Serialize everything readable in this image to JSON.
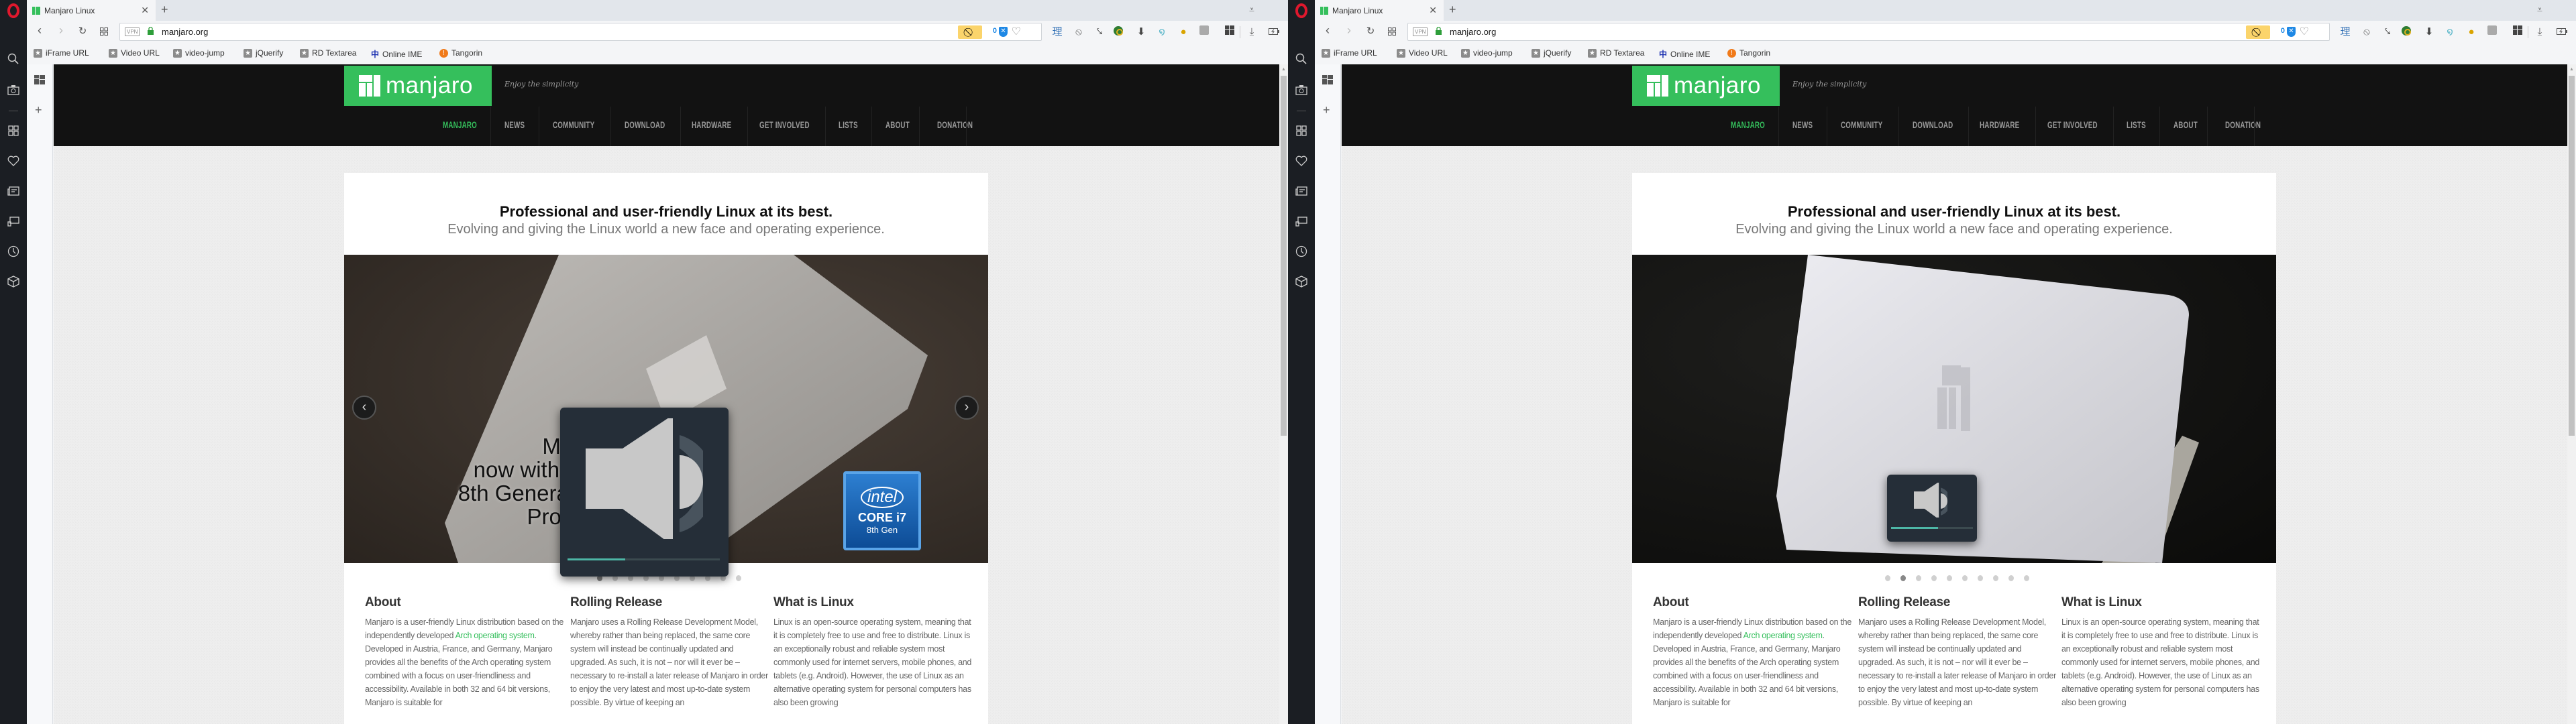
{
  "browser": {
    "tab_title": "Manjaro Linux",
    "tab_close": "✕",
    "new_tab": "+",
    "url": "manjaro.org",
    "vpn_label": "VPN",
    "blocked_count": "0",
    "bookmarks": [
      {
        "label": "iFrame URL",
        "icon": "star-icon"
      },
      {
        "label": "Video URL",
        "icon": "star-icon"
      },
      {
        "label": "video-jump",
        "icon": "star-icon"
      },
      {
        "label": "jQuerify",
        "icon": "star-icon"
      },
      {
        "label": "RD Textarea",
        "icon": "star-icon"
      },
      {
        "label": "Online IME",
        "icon": "ime-icon"
      },
      {
        "label": "Tangorin",
        "icon": "tangorin-icon"
      }
    ],
    "extension_glyph_1": "理",
    "accent": "#35bf5c"
  },
  "page": {
    "logo_text": "manjaro",
    "tagline": "Enjoy the simplicity",
    "nav": [
      "MANJARO",
      "NEWS",
      "COMMUNITY",
      "DOWNLOAD",
      "HARDWARE",
      "GET INVOLVED",
      "LISTS",
      "ABOUT",
      "DONATION"
    ],
    "active_nav": "MANJARO",
    "headline": "Professional and user-friendly Linux at its best.",
    "subheadline": "Evolving and giving the Linux world a new face and operating experience.",
    "prev_label": "‹",
    "next_label": "›",
    "slide_caption": [
      "Manjaro",
      "now with Intel Refresh",
      "8th Generation Intel Core",
      "Processors"
    ],
    "intel_badge": {
      "brand": "intel",
      "line1": "CORE i7",
      "line2": "8th Gen"
    },
    "columns": [
      {
        "title": "About",
        "text_before": "Manjaro is a user-friendly Linux distribution based on the independently developed ",
        "link": "Arch operating system",
        "text_after": ". Developed in Austria, France, and Germany, Manjaro provides all the benefits of the Arch operating system combined with a focus on user-friendliness and accessibility. Available in both 32 and 64 bit versions, Manjaro is suitable for"
      },
      {
        "title": "Rolling Release",
        "text_before": "Manjaro uses a Rolling Release Development Model, whereby rather than being replaced, the same core system will instead be continually updated and upgraded. As such, it is not – nor will it ever be – necessary to re-install a later release of Manjaro in order to enjoy the very latest and most up-to-date system possible. By virtue of keeping an",
        "link": "",
        "text_after": ""
      },
      {
        "title": "What is Linux",
        "text_before": "Linux is an open-source operating system, meaning that it is completely free to use and free to distribute. Linux is an exceptionally robust and reliable system most commonly used for internet servers, mobile phones, and tablets (e.g. Android). However, the use of Linux as an alternative operating system for personal computers has also been growing",
        "link": "",
        "text_after": ""
      }
    ],
    "slide_count": 10
  },
  "windows": [
    {
      "slide": "intel-promo",
      "active_dot": 0,
      "volume_percent": 38
    },
    {
      "slide": "laptop-photo",
      "active_dot": 1,
      "volume_percent": 57
    }
  ]
}
